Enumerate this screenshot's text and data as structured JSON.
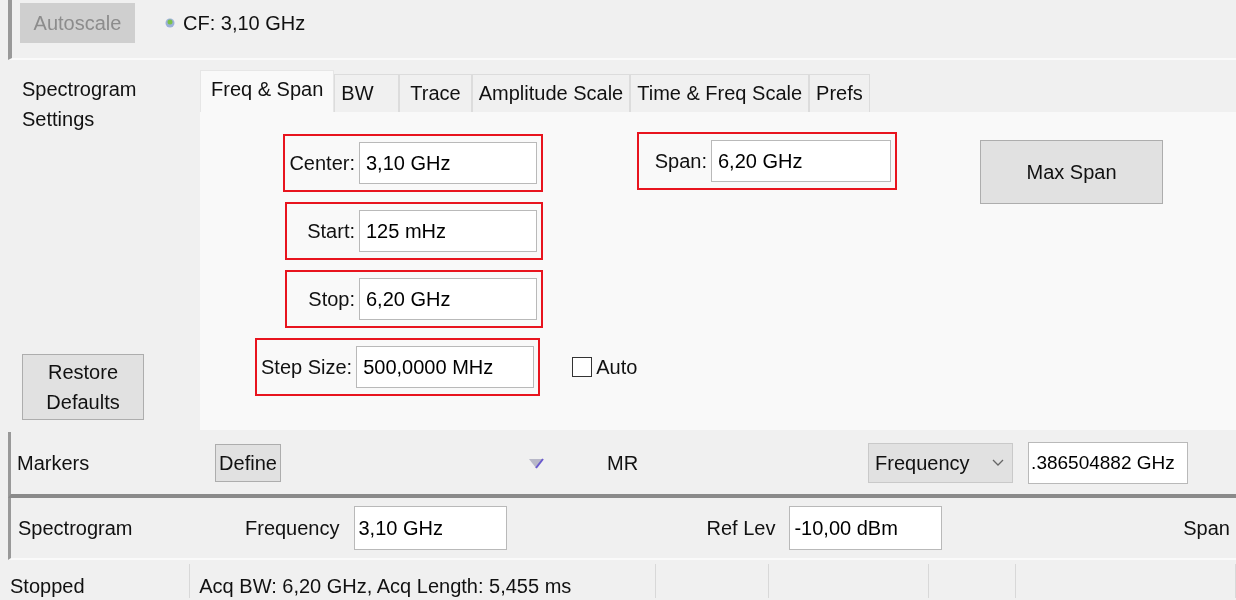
{
  "toolbar": {
    "autoscale_button": {
      "label": "Autoscale",
      "disabled": true
    },
    "cf_label": "CF: 3,10 GHz"
  },
  "settings": {
    "title": "Spectrogram Settings",
    "restore_button": "Restore Defaults",
    "tabs": [
      {
        "label": "Freq & Span",
        "selected": true
      },
      {
        "label": "BW",
        "selected": false
      },
      {
        "label": "Trace",
        "selected": false
      },
      {
        "label": "Amplitude Scale",
        "selected": false
      },
      {
        "label": "Time & Freq Scale",
        "selected": false
      },
      {
        "label": "Prefs",
        "selected": false
      }
    ],
    "fields": [
      {
        "label": "Center:",
        "value": "3,10 GHz",
        "highlighted": true
      },
      {
        "label": "Start:",
        "value": "125 mHz",
        "highlighted": true
      },
      {
        "label": "Stop:",
        "value": "6,20 GHz",
        "highlighted": true
      },
      {
        "label": "Step Size:",
        "value": "500,0000 MHz",
        "highlighted": true
      }
    ],
    "span_field": {
      "label": "Span:",
      "value": "6,20 GHz",
      "highlighted": true
    },
    "max_span_button": "Max Span",
    "auto": {
      "label": "Auto",
      "checked": false
    }
  },
  "markers": {
    "label": "Markers",
    "define_button": "Define",
    "mr_label": "MR",
    "dropdown": "Frequency",
    "value": ".386504882 GHz"
  },
  "spectrogram_bar": {
    "label": "Spectrogram",
    "frequency_label": "Frequency",
    "frequency": "3,10 GHz",
    "ref_lev_label": "Ref Lev",
    "ref_lev": "-10,00 dBm",
    "span_label": "Span"
  },
  "status_bar": {
    "state": "Stopped",
    "info": "Acq BW: 6,20 GHz, Acq Length: 5,455 ms"
  }
}
